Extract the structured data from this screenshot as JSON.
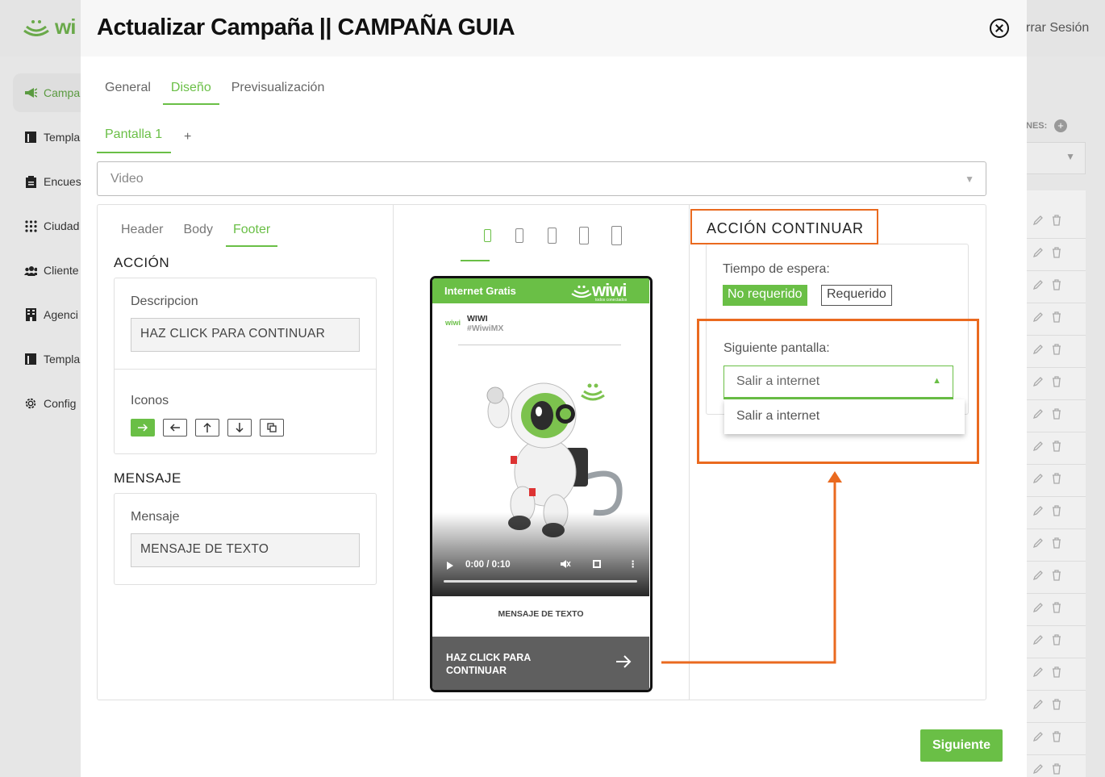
{
  "app": {
    "logo_text": "wi",
    "logout_label": "rrar Sesión"
  },
  "sidebar": {
    "items": [
      {
        "label": "Campa",
        "icon": "megaphone-icon"
      },
      {
        "label": "Templa",
        "icon": "template-icon"
      },
      {
        "label": "Encues",
        "icon": "clipboard-icon"
      },
      {
        "label": "Ciudad",
        "icon": "dots-grid-icon"
      },
      {
        "label": "Cliente",
        "icon": "users-icon"
      },
      {
        "label": "Agenci",
        "icon": "building-icon"
      },
      {
        "label": "Templa",
        "icon": "template-icon"
      },
      {
        "label": "Config",
        "icon": "gear-icon"
      }
    ]
  },
  "right_bg": {
    "label": "NES:",
    "plus": "+"
  },
  "modal": {
    "title": "Actualizar Campaña || CAMPAÑA GUIA",
    "tabs": [
      "General",
      "Diseño",
      "Previsualización"
    ],
    "active_tab": "Diseño",
    "screen_tab": "Pantalla 1",
    "add_screen": "+",
    "type_select": "Video",
    "next_button": "Siguiente"
  },
  "editor": {
    "inner_tabs": [
      "Header",
      "Body",
      "Footer"
    ],
    "active_inner_tab": "Footer",
    "accion_title": "ACCIÓN",
    "descripcion_label": "Descripcion",
    "descripcion_value": "HAZ CLICK PARA CONTINUAR",
    "iconos_label": "Iconos",
    "icons": [
      "arrow-right-icon",
      "arrow-left-icon",
      "arrow-up-icon",
      "arrow-down-icon",
      "copy-icon"
    ],
    "mensaje_title": "MENSAJE",
    "mensaje_label": "Mensaje",
    "mensaje_value": "MENSAJE DE TEXTO"
  },
  "preview": {
    "devices": [
      "phone-small-icon",
      "phone-icon",
      "phone-medium-icon",
      "phone-large-icon",
      "tablet-icon"
    ],
    "bar_title": "Internet Gratis",
    "bar_logo": "wiwi",
    "bar_tagline": "todos conectados",
    "profile_logo": "wiwi",
    "profile_name": "WIWI",
    "profile_handle": "#WiwiMX",
    "video_time": "0:00 / 0:10",
    "message": "MENSAJE DE TEXTO",
    "button_text": "HAZ CLICK PARA CONTINUAR"
  },
  "accion_continuar": {
    "title": "ACCIÓN CONTINUAR",
    "tiempo_label": "Tiempo de espera:",
    "options": [
      "No requerido",
      "Requerido"
    ],
    "selected_option": "No requerido",
    "siguiente_label": "Siguiente pantalla:",
    "siguiente_value": "Salir a internet",
    "dropdown_options": [
      "Salir a internet"
    ]
  },
  "colors": {
    "accent": "#6abf46",
    "annotation": "#ea6a1f"
  }
}
